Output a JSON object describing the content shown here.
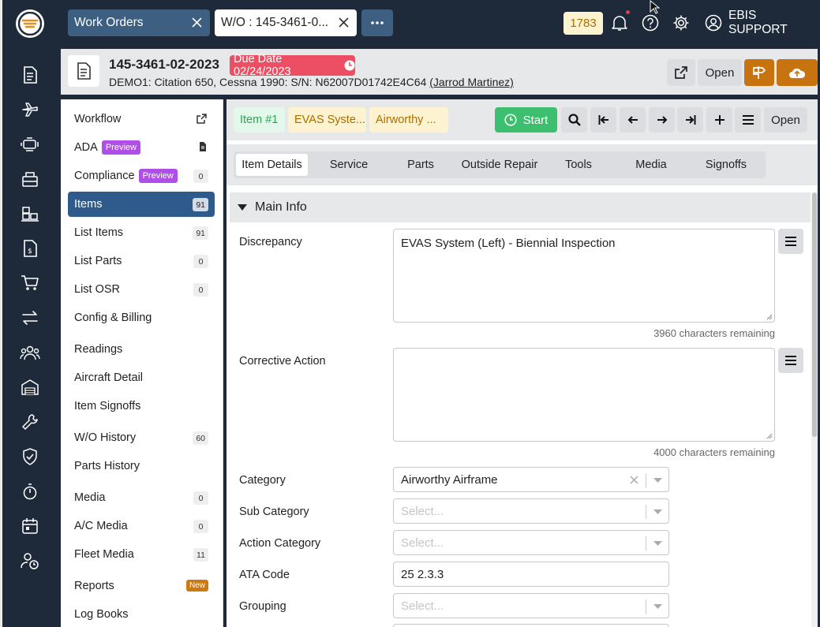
{
  "rail": {
    "icons": [
      "logo-icon",
      "document-icon",
      "airplane-icon",
      "engine-icon",
      "parts-bin-icon",
      "inventory-icon",
      "invoice-icon",
      "cart-icon",
      "transfer-icon",
      "users-icon",
      "hangar-icon",
      "wrench-icon",
      "shield-check-icon",
      "stopwatch-icon",
      "calendar-icon",
      "user-clock-icon"
    ]
  },
  "topbar": {
    "tabs": [
      {
        "label": "Work Orders"
      },
      {
        "label": "W/O : 145-3461-0..."
      }
    ],
    "more_label": "···",
    "notification_count": "1783",
    "user_name": "EBIS SUPPORT",
    "accent": "#1e2a3a"
  },
  "header": {
    "wo_number": "145-3461-02-2023",
    "due_date": "Due Date 02/24/2023",
    "aircraft": "DEMO1: Citation 650, Cessna 1990: S/N: N62007D01742E4C64",
    "owner": "(Jarrod Martinez)",
    "open_label": "Open",
    "due_color": "#ec4f63",
    "action_color": "#c77410"
  },
  "menu": {
    "items": [
      {
        "label": "Workflow",
        "icon": "external-link-icon"
      },
      {
        "label": "ADA",
        "badge": "Preview",
        "icon": "pdf-file-icon"
      },
      {
        "label": "Compliance",
        "badge": "Preview",
        "count": "0"
      },
      {
        "label": "Items",
        "count": "91"
      },
      {
        "label": "List Items",
        "count": "91"
      },
      {
        "label": "List Parts",
        "count": "0"
      },
      {
        "label": "List OSR",
        "count": "0"
      },
      {
        "label": "Config & Billing"
      },
      {
        "label": "Readings"
      },
      {
        "label": "Aircraft Detail"
      },
      {
        "label": "Item Signoffs"
      },
      {
        "label": "W/O History",
        "count": "60"
      },
      {
        "label": "Parts History"
      },
      {
        "label": "Media",
        "count": "0"
      },
      {
        "label": "A/C Media",
        "count": "0"
      },
      {
        "label": "Fleet Media",
        "count": "11"
      },
      {
        "label": "Reports",
        "new": "New"
      },
      {
        "label": "Log Books"
      }
    ]
  },
  "itembar": {
    "chips": [
      "Item #1",
      "EVAS Syste...",
      "Airworthy ..."
    ],
    "start_label": "Start",
    "open_label": "Open"
  },
  "subtabs": [
    "Item Details",
    "Service",
    "Parts",
    "Outside Repair",
    "Tools",
    "Media",
    "Signoffs"
  ],
  "form": {
    "section_title": "Main Info",
    "discrepancy_label": "Discrepancy",
    "discrepancy_value": "EVAS System (Left) - Biennial Inspection",
    "discrepancy_remaining": "3960 characters remaining",
    "corrective_label": "Corrective Action",
    "corrective_value": "",
    "corrective_remaining": "4000 characters remaining",
    "category_label": "Category",
    "category_value": "Airworthy Airframe",
    "subcategory_label": "Sub Category",
    "action_category_label": "Action Category",
    "ata_label": "ATA Code",
    "ata_value": "25 2.3.3",
    "grouping_label": "Grouping",
    "select_placeholder": "Select..."
  }
}
